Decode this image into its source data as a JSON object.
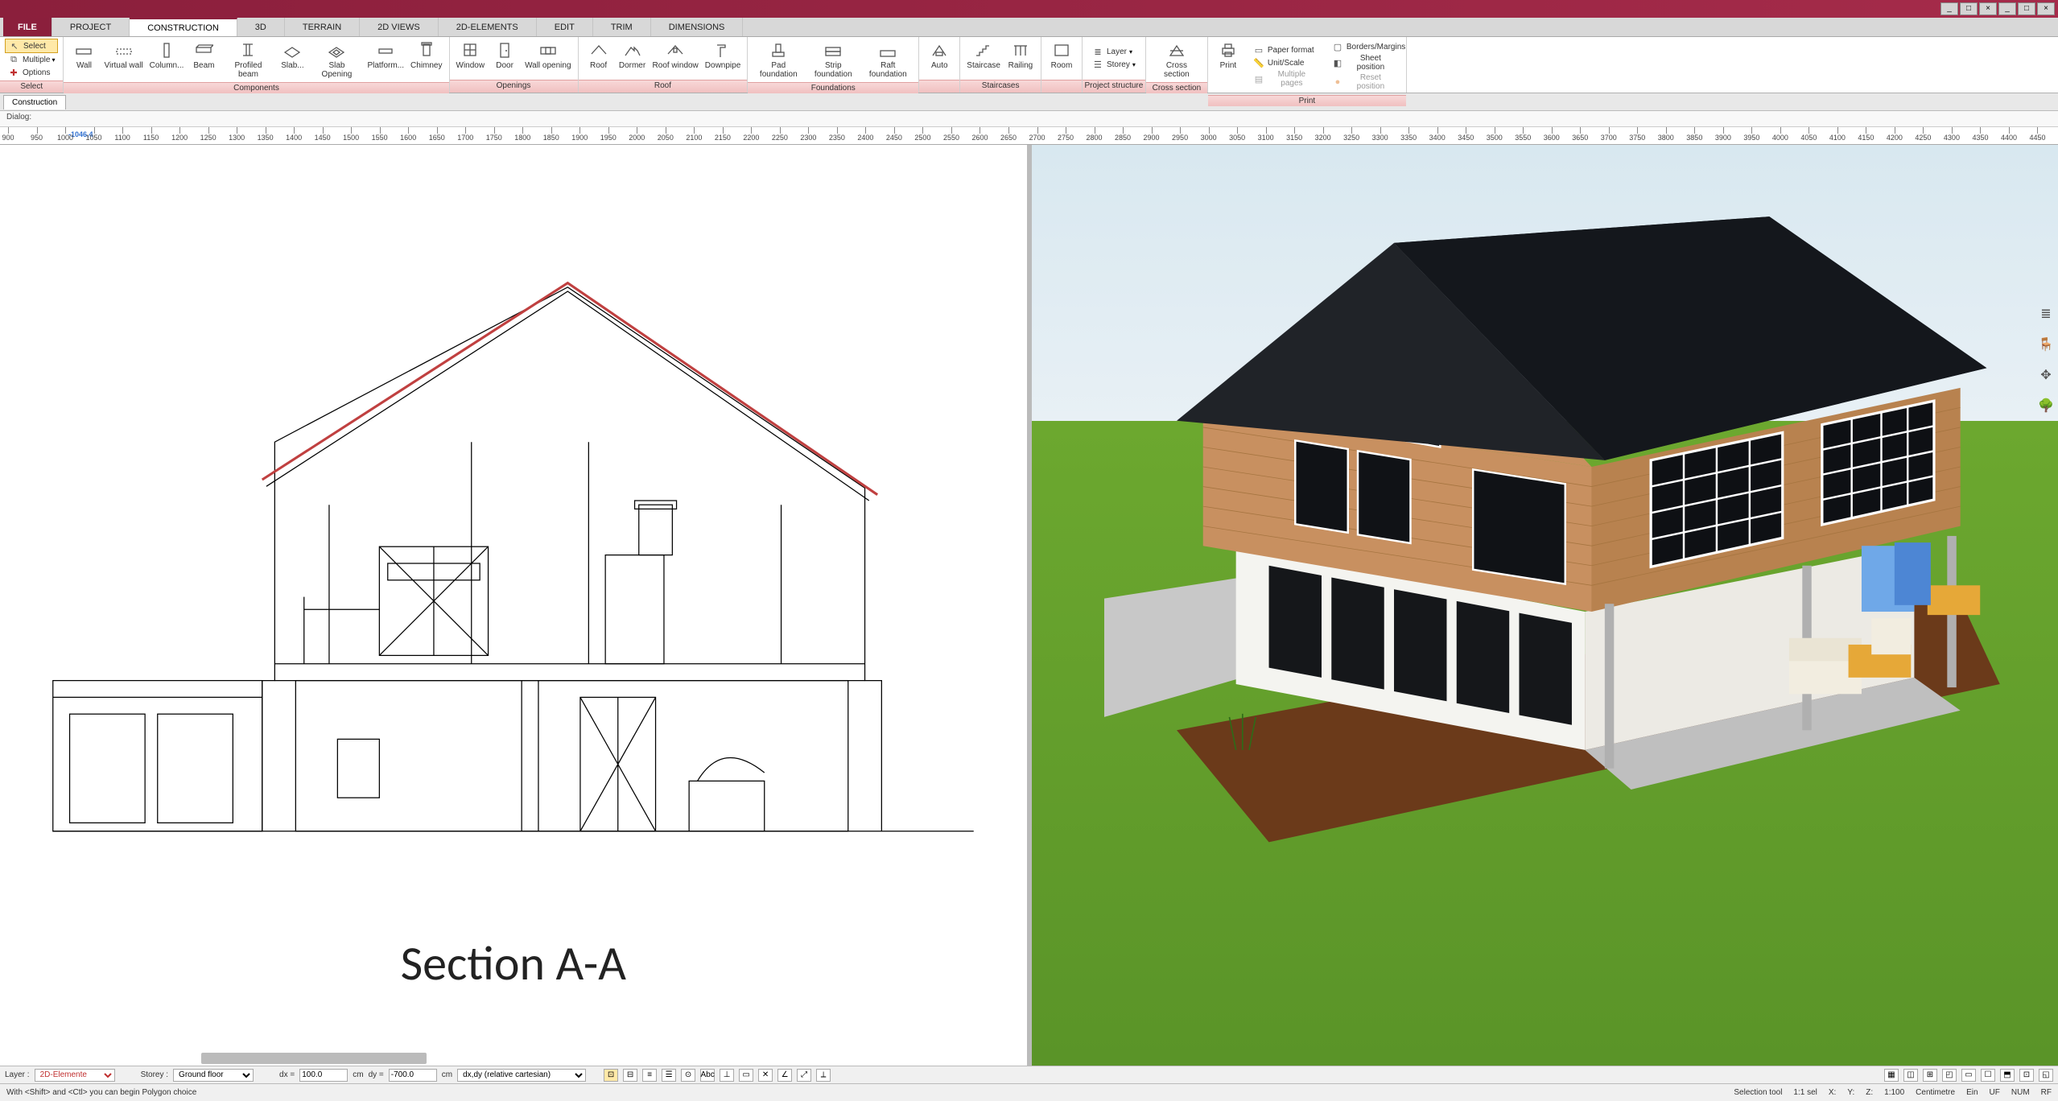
{
  "menu_tabs": [
    "FILE",
    "PROJECT",
    "CONSTRUCTION",
    "3D",
    "TERRAIN",
    "2D VIEWS",
    "2D-ELEMENTS",
    "EDIT",
    "TRIM",
    "DIMENSIONS"
  ],
  "active_tab": "CONSTRUCTION",
  "ribbon": {
    "select": {
      "name": "Select",
      "btns": [
        "Select",
        "Multiple",
        "Options"
      ]
    },
    "components": {
      "name": "Components",
      "btns": [
        "Wall",
        "Virtual wall",
        "Column...",
        "Beam",
        "Profiled beam",
        "Slab...",
        "Slab Opening",
        "Platform...",
        "Chimney"
      ]
    },
    "openings": {
      "name": "Openings",
      "btns": [
        "Window",
        "Door",
        "Wall opening"
      ]
    },
    "roof": {
      "name": "Roof",
      "btns": [
        "Roof",
        "Dormer",
        "Roof window",
        "Downpipe"
      ]
    },
    "foundations": {
      "name": "Foundations",
      "btns": [
        "Pad foundation",
        "Strip foundation",
        "Raft foundation"
      ]
    },
    "auto": {
      "name": "",
      "btns": [
        "Auto"
      ]
    },
    "staircases": {
      "name": "Staircases",
      "btns": [
        "Staircase",
        "Railing"
      ]
    },
    "room": {
      "name": "",
      "btns": [
        "Room"
      ]
    },
    "project": {
      "name": "Project structure",
      "btns": [
        "Layer",
        "Storey"
      ]
    },
    "cross": {
      "name": "Cross section",
      "btns": [
        "Cross section"
      ]
    },
    "print": {
      "name": "Print",
      "btns": [
        "Print"
      ],
      "opts": [
        "Paper format",
        "Unit/Scale",
        "Multiple pages",
        "Borders/Margins",
        "Sheet position",
        "Reset position"
      ]
    }
  },
  "subtab": "Construction",
  "dialog_label": "Dialog:",
  "ruler_origin": 900,
  "ruler_step": 50,
  "ruler_marker": "-1046,4",
  "section_title": "Section A-A",
  "bottombar": {
    "layer_lbl": "Layer :",
    "layer_val": "2D-Elemente",
    "storey_lbl": "Storey :",
    "storey_val": "Ground floor",
    "dx_lbl": "dx =",
    "dx_val": "100.0",
    "dx_unit": "cm",
    "dy_lbl": "dy =",
    "dy_val": "-700.0",
    "dy_unit": "cm",
    "coord_mode": "dx,dy (relative cartesian)"
  },
  "status": {
    "hint": "With <Shift> and <Ctl> you can begin Polygon choice",
    "tool": "Selection tool",
    "sel": "1:1 sel",
    "x": "X:",
    "y": "Y:",
    "z": "Z:",
    "scale": "1:100",
    "unit": "Centimetre",
    "ein": "Ein",
    "uf": "UF",
    "num": "NUM",
    "rf": "RF"
  },
  "window_buttons": [
    "_",
    "□",
    "×",
    "_",
    "□",
    "×"
  ]
}
